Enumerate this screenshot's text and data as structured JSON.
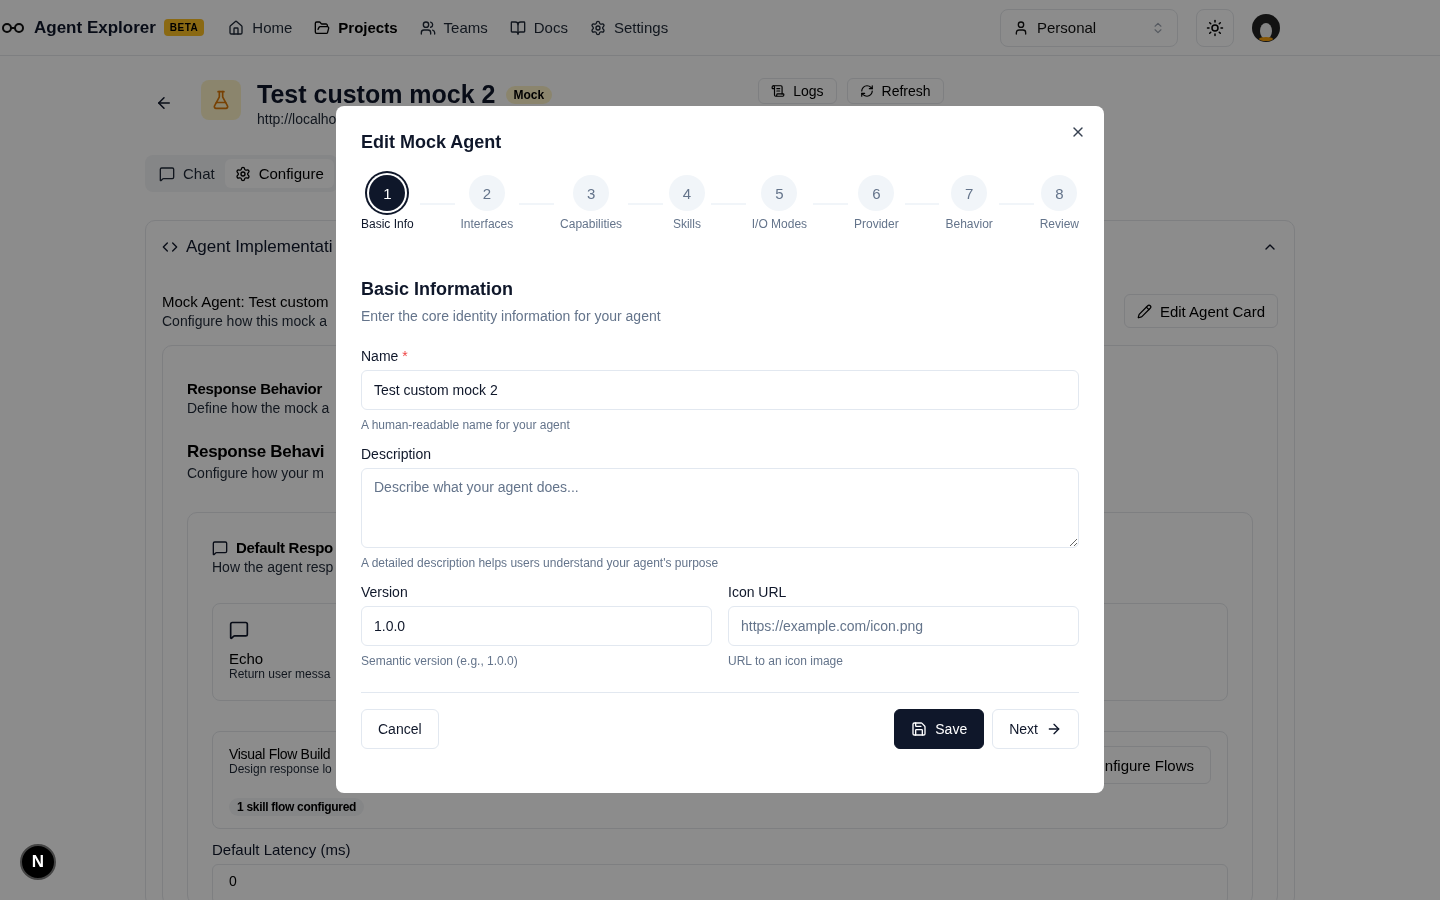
{
  "nav": {
    "brand": "Agent Explorer",
    "badge": "BETA",
    "items": [
      {
        "label": "Home",
        "selected": false
      },
      {
        "label": "Projects",
        "selected": true
      },
      {
        "label": "Teams",
        "selected": false
      },
      {
        "label": "Docs",
        "selected": false
      },
      {
        "label": "Settings",
        "selected": false
      }
    ],
    "workspace": "Personal"
  },
  "agent": {
    "title": "Test custom mock 2",
    "badge": "Mock",
    "url": "http://localho",
    "actions": [
      "Logs",
      "Refresh"
    ]
  },
  "tabs": [
    {
      "label": "Chat",
      "selected": false
    },
    {
      "label": "Configure",
      "selected": true
    }
  ],
  "implementation": {
    "title": "Agent Implementati",
    "expanded": true,
    "heading": "Mock Agent: Test custom",
    "subheading": "Configure how this mock a",
    "edit_button": "Edit Agent Card",
    "behavior": {
      "title": "Response Behavior",
      "subtitle": "Define how the mock a",
      "heading": "Response Behavi",
      "description": "Configure how your m",
      "default_response": {
        "title": "Default Respo",
        "subtitle": "How the agent resp",
        "option": {
          "title": "Echo",
          "description": "Return user messa"
        }
      },
      "flow": {
        "title": "Visual Flow Build",
        "description": "Design response lo",
        "badge": "1 skill flow configured",
        "button": "nfigure Flows"
      },
      "latency": {
        "label": "Default Latency (ms)",
        "value": "0"
      }
    }
  },
  "dev_badge": "N",
  "modal": {
    "title": "Edit Mock Agent",
    "steps": [
      {
        "number": "1",
        "label": "Basic Info",
        "selected": true
      },
      {
        "number": "2",
        "label": "Interfaces",
        "selected": false
      },
      {
        "number": "3",
        "label": "Capabilities",
        "selected": false
      },
      {
        "number": "4",
        "label": "Skills",
        "selected": false
      },
      {
        "number": "5",
        "label": "I/O Modes",
        "selected": false
      },
      {
        "number": "6",
        "label": "Provider",
        "selected": false
      },
      {
        "number": "7",
        "label": "Behavior",
        "selected": false
      },
      {
        "number": "8",
        "label": "Review",
        "selected": false
      }
    ],
    "section_title": "Basic Information",
    "section_subtitle": "Enter the core identity information for your agent",
    "name": {
      "label": "Name",
      "required_mark": "*",
      "value": "Test custom mock 2",
      "help": "A human-readable name for your agent"
    },
    "description": {
      "label": "Description",
      "placeholder": "Describe what your agent does...",
      "help": "A detailed description helps users understand your agent's purpose"
    },
    "version": {
      "label": "Version",
      "value": "1.0.0",
      "help": "Semantic version (e.g., 1.0.0)"
    },
    "icon_url": {
      "label": "Icon URL",
      "placeholder": "https://example.com/icon.png",
      "help": "URL to an icon image"
    },
    "buttons": {
      "cancel": "Cancel",
      "save": "Save",
      "next": "Next"
    }
  }
}
